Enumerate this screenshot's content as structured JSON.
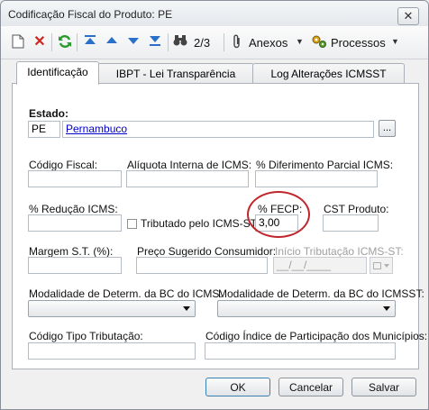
{
  "window": {
    "title": "Codificação Fiscal do Produto: PE",
    "close_glyph": "✕"
  },
  "toolbar": {
    "page_indicator": "2/3",
    "anexos_label": "Anexos",
    "processos_label": "Processos"
  },
  "tabs": [
    {
      "label": "Identificação",
      "active": true
    },
    {
      "label": "IBPT - Lei Transparência",
      "active": false
    },
    {
      "label": "Log Alterações ICMSST",
      "active": false
    }
  ],
  "form": {
    "estado_label": "Estado:",
    "estado_code": "PE",
    "estado_name": "Pernambuco",
    "lookup_button": "...",
    "codigo_fiscal_label": "Código Fiscal:",
    "codigo_fiscal_value": "",
    "aliquota_label": "Alíquota Interna de ICMS:",
    "aliquota_value": "",
    "diferimento_label": "% Diferimento Parcial ICMS:",
    "diferimento_value": "",
    "reducao_label": "% Redução ICMS:",
    "reducao_value": "",
    "tributado_label": "Tributado pelo ICMS-ST",
    "fecp_label": "% FECP:",
    "fecp_value": "3,00",
    "cst_label": "CST Produto:",
    "cst_value": "",
    "margem_label": "Margem S.T. (%):",
    "margem_value": "",
    "preco_label": "Preço Sugerido Consumidor:",
    "preco_value": "",
    "inicio_label": "Início Tributação ICMS-ST:",
    "inicio_value": "__/__/____",
    "modalidade_icms_label": "Modalidade de Determ. da BC do ICMS:",
    "modalidade_icmsst_label": "Modalidade de Determ. da BC do ICMSST:",
    "codigo_tributacao_label": "Código Tipo Tributação:",
    "codigo_tributacao_value": "",
    "indice_label": "Código Índice de Participação dos Municípios:",
    "indice_value": ""
  },
  "buttons": {
    "ok": "OK",
    "cancel": "Cancelar",
    "save": "Salvar"
  },
  "colors": {
    "highlight_circle": "#c0272d",
    "link": "#0000cc"
  }
}
